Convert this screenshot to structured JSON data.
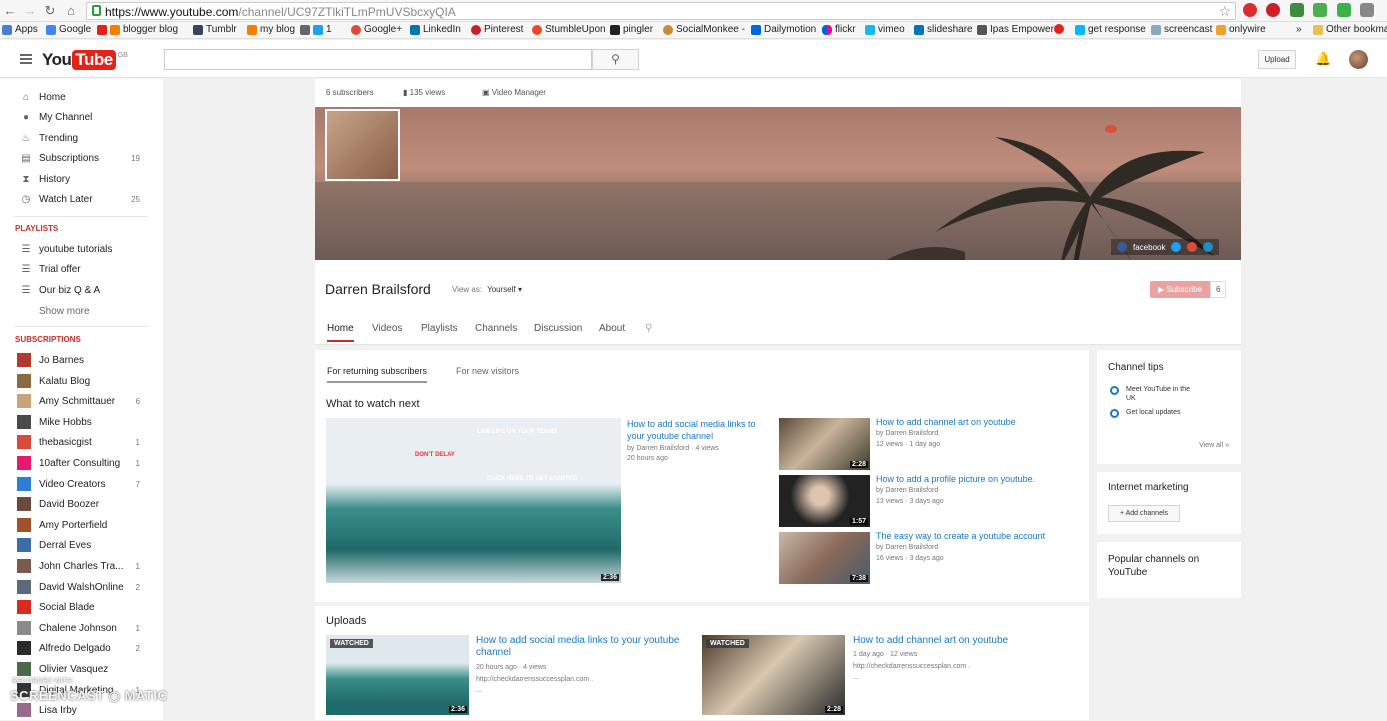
{
  "browser": {
    "url_host": "https://www.youtube.com",
    "url_path": "/channel/UC97ZTlkiTLmPmUVSbcxyQIA",
    "bookmarks": [
      "Apps",
      "Google",
      "blogger blog",
      "Tumblr",
      "my blog",
      "1",
      "Google+",
      "LinkedIn",
      "Pinterest",
      "StumbleUpon",
      "pingler",
      "SocialMonkee -",
      "Dailymotion",
      "flickr",
      "vimeo",
      "slideshare",
      "Ipas Empower",
      "get response",
      "screencast",
      "onlywire",
      "Other bookmarks"
    ]
  },
  "header": {
    "logo_you": "You",
    "logo_tube": "Tube",
    "logo_region": "GB",
    "upload_label": "Upload"
  },
  "sidebar": {
    "nav": [
      {
        "label": "Home",
        "icon": "home-icon",
        "count": ""
      },
      {
        "label": "My Channel",
        "icon": "person-icon",
        "count": ""
      },
      {
        "label": "Trending",
        "icon": "flame-icon",
        "count": ""
      },
      {
        "label": "Subscriptions",
        "icon": "subscriptions-icon",
        "count": "19"
      },
      {
        "label": "History",
        "icon": "hourglass-icon",
        "count": ""
      },
      {
        "label": "Watch Later",
        "icon": "clock-icon",
        "count": "25"
      }
    ],
    "playlists_heading": "PLAYLISTS",
    "playlists": [
      "youtube tutorials",
      "Trial offer",
      "Our biz Q & A"
    ],
    "show_more": "Show more",
    "subscriptions_heading": "SUBSCRIPTIONS",
    "subscriptions": [
      {
        "label": "Jo Barnes",
        "count": "",
        "color": "#b23a2f"
      },
      {
        "label": "Kalatu Blog",
        "count": "",
        "color": "#8a6b3f"
      },
      {
        "label": "Amy Schmittauer",
        "count": "6",
        "color": "#c9a37a"
      },
      {
        "label": "Mike Hobbs",
        "count": "",
        "color": "#4a4a4a"
      },
      {
        "label": "thebasicgist",
        "count": "1",
        "color": "#d84b3c"
      },
      {
        "label": "10after Consulting",
        "count": "1",
        "color": "#e6196e"
      },
      {
        "label": "Video Creators",
        "count": "7",
        "color": "#2f7fd0"
      },
      {
        "label": "David Boozer",
        "count": "",
        "color": "#6a4a3a"
      },
      {
        "label": "Amy Porterfield",
        "count": "",
        "color": "#a0522d"
      },
      {
        "label": "Derral Eves",
        "count": "",
        "color": "#3a6ea5"
      },
      {
        "label": "John Charles Tra...",
        "count": "1",
        "color": "#7a5a4a"
      },
      {
        "label": "David WalshOnline",
        "count": "2",
        "color": "#5a6a7a"
      },
      {
        "label": "Social Blade",
        "count": "",
        "color": "#d62d20"
      },
      {
        "label": "Chalene Johnson",
        "count": "1",
        "color": "#8a8a8a"
      },
      {
        "label": "Alfredo Delgado",
        "count": "2",
        "color": "#2b2b2b"
      },
      {
        "label": "Olivier Vasquez",
        "count": "",
        "color": "#4a6a4a"
      },
      {
        "label": "Digital Marketing",
        "count": "1",
        "color": "#333333"
      },
      {
        "label": "Lisa Irby",
        "count": "",
        "color": "#9a6a8a"
      }
    ]
  },
  "channel": {
    "subscribers": "6 subscribers",
    "views": "135 views",
    "video_manager": "Video Manager",
    "name": "Darren Brailsford",
    "view_as_label": "View as:",
    "view_as_value": "Yourself",
    "subscribe_label": "Subscribe",
    "subscribe_count": "6",
    "social_label": "facebook",
    "tabs": [
      "Home",
      "Videos",
      "Playlists",
      "Channels",
      "Discussion",
      "About"
    ]
  },
  "content": {
    "subtabs": [
      "For returning subscribers",
      "For new visitors"
    ],
    "what_to_watch": "What to watch next",
    "featured": {
      "title": "How to add social media links to your youtube channel",
      "meta1": "by Darren Brailsford · 4 views",
      "meta2": "20 hours ago",
      "duration": "2:36",
      "overlay1": "LIVE LIFE ON YOUR TERMS",
      "overlay2": "DON'T DELAY",
      "overlay3": "CLICK HERE TO GET STARTED"
    },
    "list": [
      {
        "title": "How to add channel art on youtube",
        "by": "by Darren Brailsford",
        "meta": "12 views · 1 day ago",
        "duration": "2:28"
      },
      {
        "title": "How to add a profile picture on youtube.",
        "by": "by Darren Brailsford",
        "meta": "13 views · 3 days ago",
        "duration": "1:57"
      },
      {
        "title": "The easy way to create a youtube account",
        "by": "by Darren Brailsford",
        "meta": "16 views · 3 days ago",
        "duration": "7:38"
      }
    ],
    "uploads_heading": "Uploads",
    "uploads": [
      {
        "title": "How to add social media links to your youtube channel",
        "meta": "20 hours ago · 4 views",
        "desc": "http://checkdarrenssuccessplan.com .",
        "extra": "...",
        "duration": "2:36",
        "badge": "WATCHED"
      },
      {
        "title": "How to add channel art on youtube",
        "meta": "1 day ago · 12 views",
        "desc": "http://checkdarrenssuccessplan.com .",
        "extra": "...",
        "duration": "2:28",
        "badge": "WATCHED"
      }
    ]
  },
  "right": {
    "tips_title": "Channel tips",
    "tips": [
      "Meet YouTube in the UK",
      "Get local updates"
    ],
    "view_all": "View all »",
    "internet_marketing": "Internet marketing",
    "add_channels": "+ Add channels",
    "popular": "Popular channels on YouTube"
  },
  "watermark": {
    "recorded": "RECORDED WITH",
    "brand": "SCREENCAST ◉ MATIC"
  }
}
